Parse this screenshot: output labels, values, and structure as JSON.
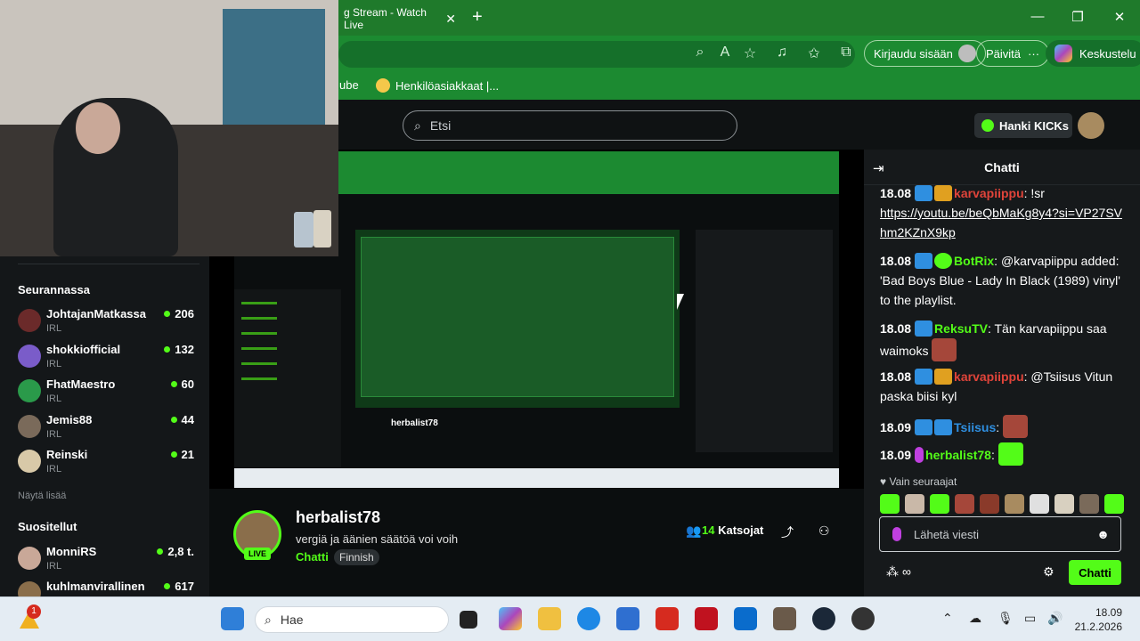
{
  "browser": {
    "tab_title": "g Stream - Watch Live",
    "signin_label": "Kirjaudu sisään",
    "update_label": "Päivitä",
    "copilot_label": "Keskustelu",
    "bookmarks": [
      "ube",
      "Henkilöasiakkaat |..."
    ]
  },
  "kick": {
    "search_placeholder": "Etsi",
    "get_kicks_label": "Hanki KICKs"
  },
  "sidebar": {
    "following_title": "Seurannassa",
    "following": [
      {
        "name": "JohtajanMatkassa",
        "category": "IRL",
        "count": "206",
        "color": "#6b2a2a"
      },
      {
        "name": "shokkiofficial",
        "category": "IRL",
        "count": "132",
        "color": "#7a5cc9"
      },
      {
        "name": "FhatMaestro",
        "category": "IRL",
        "count": "60",
        "color": "#2a9a4a"
      },
      {
        "name": "Jemis88",
        "category": "IRL",
        "count": "44",
        "color": "#7a6a5a"
      },
      {
        "name": "Reinski",
        "category": "IRL",
        "count": "21",
        "color": "#d8c9a8"
      }
    ],
    "show_more": "Näytä lisää",
    "recommended_title": "Suositellut",
    "recommended": [
      {
        "name": "MonniRS",
        "category": "IRL",
        "count": "2,8 t.",
        "color": "#c9a898"
      },
      {
        "name": "kuhlmanvirallinen",
        "category": "",
        "count": "617",
        "color": "#8a6e4b"
      }
    ]
  },
  "stream": {
    "streamer": "herbalist78",
    "title": "vergiä ja äänien säätöä voi voih",
    "category": "Chatti",
    "language": "Finnish",
    "live_badge": "LIVE",
    "viewers": "14",
    "viewers_label": "Katsojat",
    "inner_title": "herbalist78"
  },
  "chat": {
    "header": "Chatti",
    "messages": [
      {
        "time": "18.08",
        "user": "karvapiippu",
        "user_color": "#e0443a",
        "text": ": !sr",
        "link": "https://youtu.be/beQbMaKg8y4?si=VP27SVhm2KZnX9kp"
      },
      {
        "time": "18.08",
        "user": "BotRix",
        "user_color": "#53fc18",
        "text": ": @karvapiippu added: 'Bad Boys Blue - Lady In Black (1989) vinyl' to the playlist."
      },
      {
        "time": "18.08",
        "user": "ReksuTV",
        "user_color": "#53fc18",
        "text": ": Tän karvapiippu saa waimoks"
      },
      {
        "time": "18.08",
        "user": "karvapiippu",
        "user_color": "#e0443a",
        "text": ": @Tsiisus Vitun paska biisi kyl"
      },
      {
        "time": "18.09",
        "user": "Tsiisus",
        "user_color": "#2f8fe0",
        "text": ":"
      },
      {
        "time": "18.09",
        "user": "herbalist78",
        "user_color": "#53fc18",
        "text": ":"
      }
    ],
    "followers_only": "Vain seuraajat",
    "input_placeholder": "Lähetä viesti",
    "send_label": "Chatti",
    "infinity": "∞"
  },
  "taskbar": {
    "search_placeholder": "Hae",
    "notif_count": "1",
    "time": "18.09",
    "date": "21.2.2026"
  }
}
